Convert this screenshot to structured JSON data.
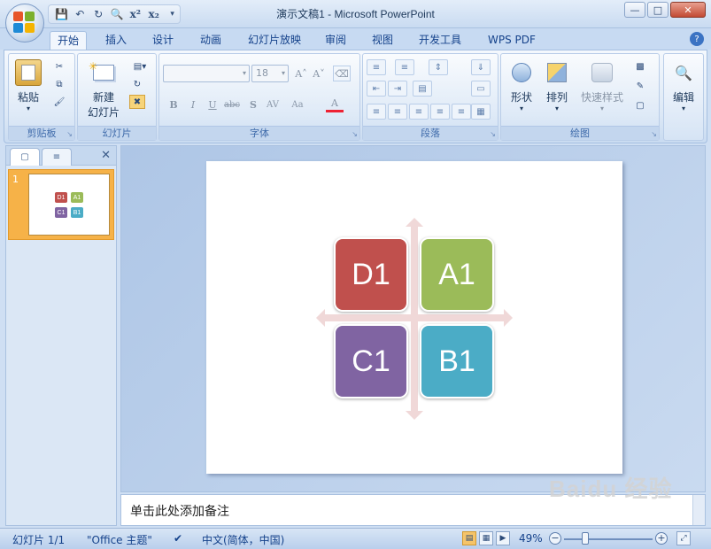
{
  "window": {
    "title": "演示文稿1 - Microsoft PowerPoint"
  },
  "qat": {
    "icons": [
      "save-icon",
      "undo-icon",
      "redo-icon",
      "print-preview-icon",
      "superscript-icon",
      "subscript-icon",
      "customize-icon"
    ]
  },
  "tabs": [
    "开始",
    "插入",
    "设计",
    "动画",
    "幻灯片放映",
    "审阅",
    "视图",
    "开发工具",
    "WPS PDF"
  ],
  "active_tab": "开始",
  "ribbon": {
    "clipboard": {
      "label": "剪贴板",
      "paste": "粘贴"
    },
    "slides": {
      "label": "幻灯片",
      "new_slide": "新建",
      "new_slide_sub": "幻灯片"
    },
    "font": {
      "label": "字体",
      "font_name": "",
      "font_size": "18"
    },
    "paragraph": {
      "label": "段落"
    },
    "drawing": {
      "label": "绘图",
      "shapes": "形状",
      "arrange": "排列",
      "quick_styles": "快速样式"
    },
    "editing": {
      "label": "编辑"
    }
  },
  "thumbnail": {
    "number": "1"
  },
  "slide": {
    "tiles": [
      {
        "text": "D1",
        "color": "#c0504d"
      },
      {
        "text": "A1",
        "color": "#9bbb59"
      },
      {
        "text": "C1",
        "color": "#8064a2"
      },
      {
        "text": "B1",
        "color": "#4bacc6"
      }
    ],
    "arrow_color": "#f0d8d8"
  },
  "notes": {
    "placeholder": "单击此处添加备注"
  },
  "status": {
    "slide_count": "幻灯片 1/1",
    "theme": "\"Office 主题\"",
    "language": "中文(简体，中国)",
    "zoom": "49%"
  },
  "watermark": "Baidu 经验"
}
